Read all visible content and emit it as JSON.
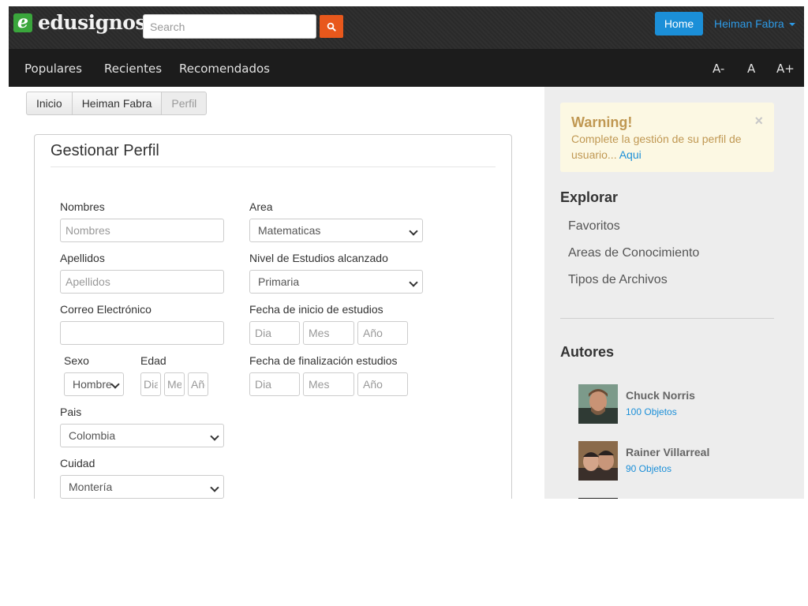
{
  "header": {
    "logo_mark": "e",
    "logo_text": "edusignos",
    "search_placeholder": "Search",
    "home_label": "Home",
    "user_name": "Heiman Fabra"
  },
  "nav": {
    "links": [
      "Populares",
      "Recientes",
      "Recomendados"
    ],
    "font_controls": [
      "A-",
      "A",
      "A+"
    ]
  },
  "breadcrumb": [
    "Inicio",
    "Heiman Fabra",
    "Perfil"
  ],
  "form": {
    "title": "Gestionar Perfil",
    "nombres_label": "Nombres",
    "nombres_placeholder": "Nombres",
    "apellidos_label": "Apellidos",
    "apellidos_placeholder": "Apellidos",
    "correo_label": "Correo Electrónico",
    "correo_value": "",
    "sexo_label": "Sexo",
    "sexo_value": "Hombre",
    "edad_label": "Edad",
    "edad_placeholders": [
      "Dia",
      "Mes",
      "Año"
    ],
    "pais_label": "Pais",
    "pais_value": "Colombia",
    "ciudad_label": "Cuidad",
    "ciudad_value": "Montería",
    "area_label": "Area",
    "area_value": "Matematicas",
    "nivel_label": "Nivel de Estudios alcanzado",
    "nivel_value": "Primaria",
    "fecha_inicio_label": "Fecha de inicio de estudios",
    "fecha_fin_label": "Fecha de finalización estudios",
    "date_placeholders": [
      "Dia",
      "Mes",
      "Año"
    ]
  },
  "sidebar": {
    "alert": {
      "title": "Warning!",
      "text": "Complete la gestión de su perfil de usuario...",
      "link": "Aqui",
      "close": "×"
    },
    "explorar_title": "Explorar",
    "explorar_links": [
      "Favoritos",
      "Areas de Conocimiento",
      "Tipos de Archivos"
    ],
    "autores_title": "Autores",
    "autores": [
      {
        "name": "Chuck Norris",
        "count": "100 Objetos"
      },
      {
        "name": "Rainer Villarreal",
        "count": "90 Objetos"
      }
    ]
  },
  "colors": {
    "accent": "#1b8fd8",
    "search_button": "#e8581c",
    "logo_green": "#3aa63c",
    "warning_text": "#c09853",
    "warning_bg": "#fcf8e3"
  }
}
